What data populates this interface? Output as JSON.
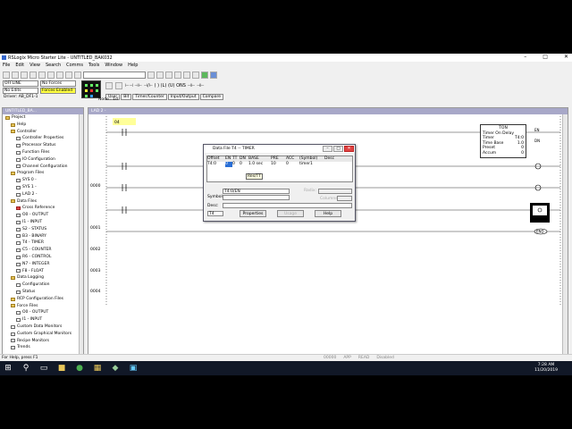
{
  "window": {
    "title": "RSLogix Micro Starter Lite - UNTITLED_BAK032",
    "controls": [
      "–",
      "□",
      "✕"
    ]
  },
  "menu": [
    "File",
    "Edit",
    "View",
    "Search",
    "Comms",
    "Tools",
    "Window",
    "Help"
  ],
  "status": {
    "mode": "OFFLINE",
    "forces": "No Forces",
    "edits": "No Edits",
    "forces_enabled": "Forces Enabled",
    "driver": "Driver: AB_DF1-1",
    "node": "Node : 1d"
  },
  "instr_tabs": [
    "User",
    "Bit",
    "Timer/Counter",
    "Input/Output",
    "Compare"
  ],
  "tree": {
    "header": "UNTITLED_BA...",
    "items": [
      {
        "label": "Project",
        "indent": 0,
        "icon": "folder"
      },
      {
        "label": "Help",
        "indent": 1,
        "icon": "folder"
      },
      {
        "label": "Controller",
        "indent": 1,
        "icon": "folder"
      },
      {
        "label": "Controller Properties",
        "indent": 2,
        "icon": "file"
      },
      {
        "label": "Processor Status",
        "indent": 2,
        "icon": "file"
      },
      {
        "label": "Function Files",
        "indent": 2,
        "icon": "file"
      },
      {
        "label": "IO Configuration",
        "indent": 2,
        "icon": "file"
      },
      {
        "label": "Channel Configuration",
        "indent": 2,
        "icon": "file"
      },
      {
        "label": "Program Files",
        "indent": 1,
        "icon": "folder"
      },
      {
        "label": "SYS 0 -",
        "indent": 2,
        "icon": "file"
      },
      {
        "label": "SYS 1 -",
        "indent": 2,
        "icon": "file"
      },
      {
        "label": "LAD 2 -",
        "indent": 2,
        "icon": "file"
      },
      {
        "label": "Data Files",
        "indent": 1,
        "icon": "folder"
      },
      {
        "label": "Cross Reference",
        "indent": 2,
        "icon": "red"
      },
      {
        "label": "O0 - OUTPUT",
        "indent": 2,
        "icon": "file"
      },
      {
        "label": "I1 - INPUT",
        "indent": 2,
        "icon": "file"
      },
      {
        "label": "S2 - STATUS",
        "indent": 2,
        "icon": "file"
      },
      {
        "label": "B3 - BINARY",
        "indent": 2,
        "icon": "file"
      },
      {
        "label": "T4 - TIMER",
        "indent": 2,
        "icon": "file"
      },
      {
        "label": "C5 - COUNTER",
        "indent": 2,
        "icon": "file"
      },
      {
        "label": "R6 - CONTROL",
        "indent": 2,
        "icon": "file"
      },
      {
        "label": "N7 - INTEGER",
        "indent": 2,
        "icon": "file"
      },
      {
        "label": "F8 - FLOAT",
        "indent": 2,
        "icon": "file"
      },
      {
        "label": "Data Logging",
        "indent": 1,
        "icon": "folder"
      },
      {
        "label": "Configuration",
        "indent": 2,
        "icon": "file"
      },
      {
        "label": "Status",
        "indent": 2,
        "icon": "file"
      },
      {
        "label": "RCP Configuration Files",
        "indent": 1,
        "icon": "folder"
      },
      {
        "label": "Force Files",
        "indent": 1,
        "icon": "folder"
      },
      {
        "label": "O0 - OUTPUT",
        "indent": 2,
        "icon": "file"
      },
      {
        "label": "I1 - INPUT",
        "indent": 2,
        "icon": "file"
      },
      {
        "label": "Custom Data Monitors",
        "indent": 1,
        "icon": "file"
      },
      {
        "label": "Custom Graphical Monitors",
        "indent": 1,
        "icon": "file"
      },
      {
        "label": "Recipe Monitors",
        "indent": 1,
        "icon": "file"
      },
      {
        "label": "Trends",
        "indent": 1,
        "icon": "file"
      }
    ]
  },
  "ladder": {
    "header": "LAD 2 -",
    "file_tab": "File 2",
    "rungs": [
      "0000",
      "0001",
      "0002",
      "0003",
      "0004"
    ],
    "first_contact_tag": "04",
    "timer": {
      "title": "TON",
      "name": "Timer On Delay",
      "rows": [
        {
          "k": "Timer",
          "v": "T4:0"
        },
        {
          "k": "Time Base",
          "v": "1.0"
        },
        {
          "k": "Preset",
          "v": "0"
        },
        {
          "k": "Accum",
          "v": "0"
        }
      ],
      "outputs": [
        "EN",
        "DN"
      ]
    },
    "end_label": "END"
  },
  "dialog": {
    "title": "Data File T4 -- TIMER",
    "columns": [
      "Offset",
      "EN",
      "TT",
      "DN",
      "BASE",
      "PRE",
      "ACC",
      "(Symbol)",
      "Desc"
    ],
    "row": [
      "T4:0",
      "0",
      "0",
      "0",
      "1.0 sec",
      "10",
      "0",
      "timer1",
      ""
    ],
    "tooltip": "Res/TT",
    "address": "T4:0/EN",
    "symbol_label": "Symbol:",
    "desc_label": "Desc:",
    "radix_label": "Radix:",
    "columns_label": "Columns:",
    "columns_value": "",
    "file_value": "T4",
    "buttons": [
      "Properties",
      "Usage",
      "Help"
    ]
  },
  "statusbar": {
    "text": "For Help, press F1",
    "right": [
      "00000",
      "APP",
      "READ",
      "Disabled"
    ]
  },
  "clock": {
    "time": "7:28 AM",
    "date": "11/20/2019"
  }
}
